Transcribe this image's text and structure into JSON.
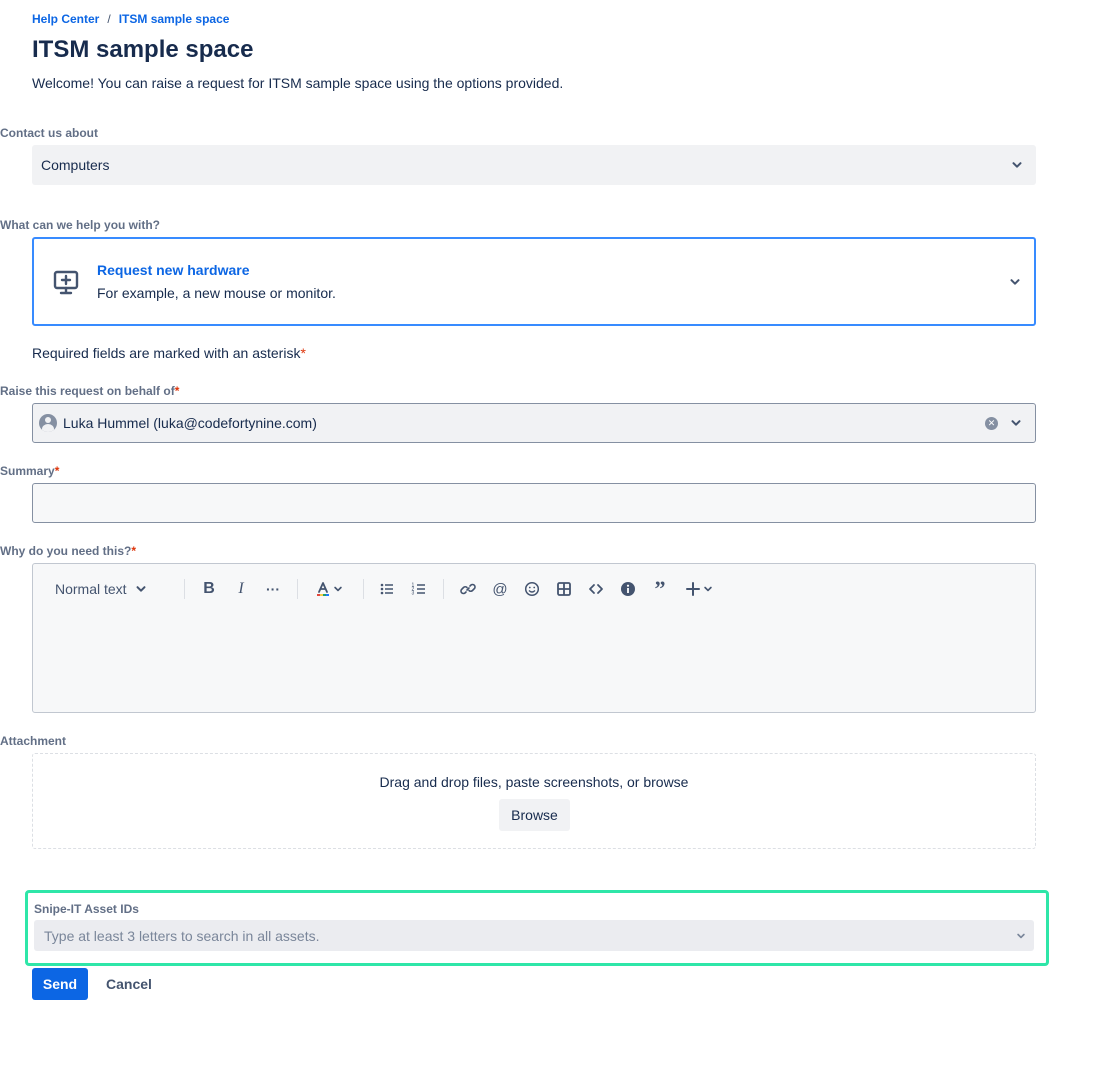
{
  "breadcrumb": {
    "home": "Help Center",
    "separator": "/",
    "current": "ITSM sample space"
  },
  "page": {
    "title": "ITSM sample space",
    "welcome": "Welcome! You can raise a request for ITSM sample space using the options provided."
  },
  "contact": {
    "label": "Contact us about",
    "value": "Computers"
  },
  "help": {
    "label": "What can we help you with?",
    "request_title": "Request new hardware",
    "request_description": "For example, a new mouse or monitor.",
    "icon": "monitor-plus-icon"
  },
  "required_note": {
    "text": "Required fields are marked with an asterisk",
    "asterisk": "*"
  },
  "behalf": {
    "label": "Raise this request on behalf of",
    "asterisk": "*",
    "value": "Luka Hummel (luka@codefortynine.com)"
  },
  "summary": {
    "label": "Summary",
    "asterisk": "*",
    "value": ""
  },
  "why": {
    "label": "Why do you need this?",
    "asterisk": "*"
  },
  "editor_toolbar": {
    "text_style": "Normal text",
    "icons": [
      "bold-icon",
      "italic-icon",
      "more-icon",
      "text-color-icon",
      "bullet-list-icon",
      "numbered-list-icon",
      "link-icon",
      "mention-icon",
      "emoji-icon",
      "table-icon",
      "code-icon",
      "info-icon",
      "quote-icon",
      "insert-icon"
    ]
  },
  "attachment": {
    "label": "Attachment",
    "drop_text": "Drag and drop files, paste screenshots, or browse",
    "browse_label": "Browse"
  },
  "snipe_it": {
    "label": "Snipe-IT Asset IDs",
    "placeholder": "Type at least 3 letters to search in all assets."
  },
  "actions": {
    "send_label": "Send",
    "cancel_label": "Cancel"
  },
  "colors": {
    "primary": "#0c66e4",
    "focus_border": "#388bff",
    "highlight": "#2ee6a8",
    "required": "#de350b"
  }
}
